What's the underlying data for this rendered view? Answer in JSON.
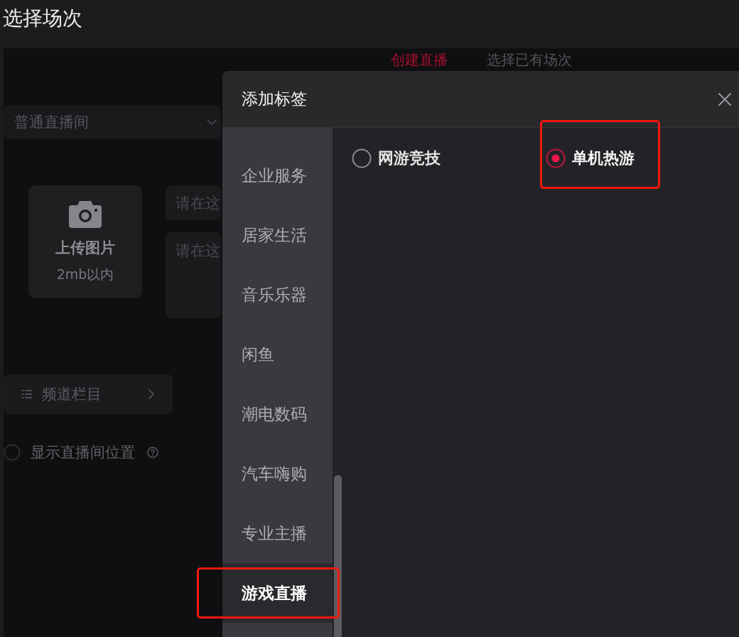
{
  "page": {
    "title": "选择场次"
  },
  "tabs": [
    {
      "label": "创建直播",
      "selected": true
    },
    {
      "label": "选择已有场次",
      "selected": false
    }
  ],
  "form": {
    "room_type": {
      "value": "普通直播间"
    },
    "upload": {
      "label": "上传图片",
      "hint": "2mb以内"
    },
    "fields": [
      {
        "kind": "single",
        "placeholder": "请在这"
      },
      {
        "kind": "multi",
        "placeholder": "请在这"
      }
    ],
    "channel": {
      "label": "频道栏目"
    },
    "show_location": {
      "label": "显示直播间位置",
      "checked": false
    }
  },
  "dialog": {
    "title": "添加标签",
    "categories": [
      {
        "label": "企业服务",
        "selected": false,
        "highlighted": false
      },
      {
        "label": "居家生活",
        "selected": false,
        "highlighted": false
      },
      {
        "label": "音乐乐器",
        "selected": false,
        "highlighted": false
      },
      {
        "label": "闲鱼",
        "selected": false,
        "highlighted": false
      },
      {
        "label": "潮电数码",
        "selected": false,
        "highlighted": false
      },
      {
        "label": "汽车嗨购",
        "selected": false,
        "highlighted": false
      },
      {
        "label": "专业主播",
        "selected": false,
        "highlighted": false
      },
      {
        "label": "游戏直播",
        "selected": true,
        "highlighted": true
      }
    ],
    "options": [
      {
        "label": "网游竞技",
        "selected": false,
        "highlighted": false
      },
      {
        "label": "单机热游",
        "selected": true,
        "highlighted": true
      }
    ]
  }
}
